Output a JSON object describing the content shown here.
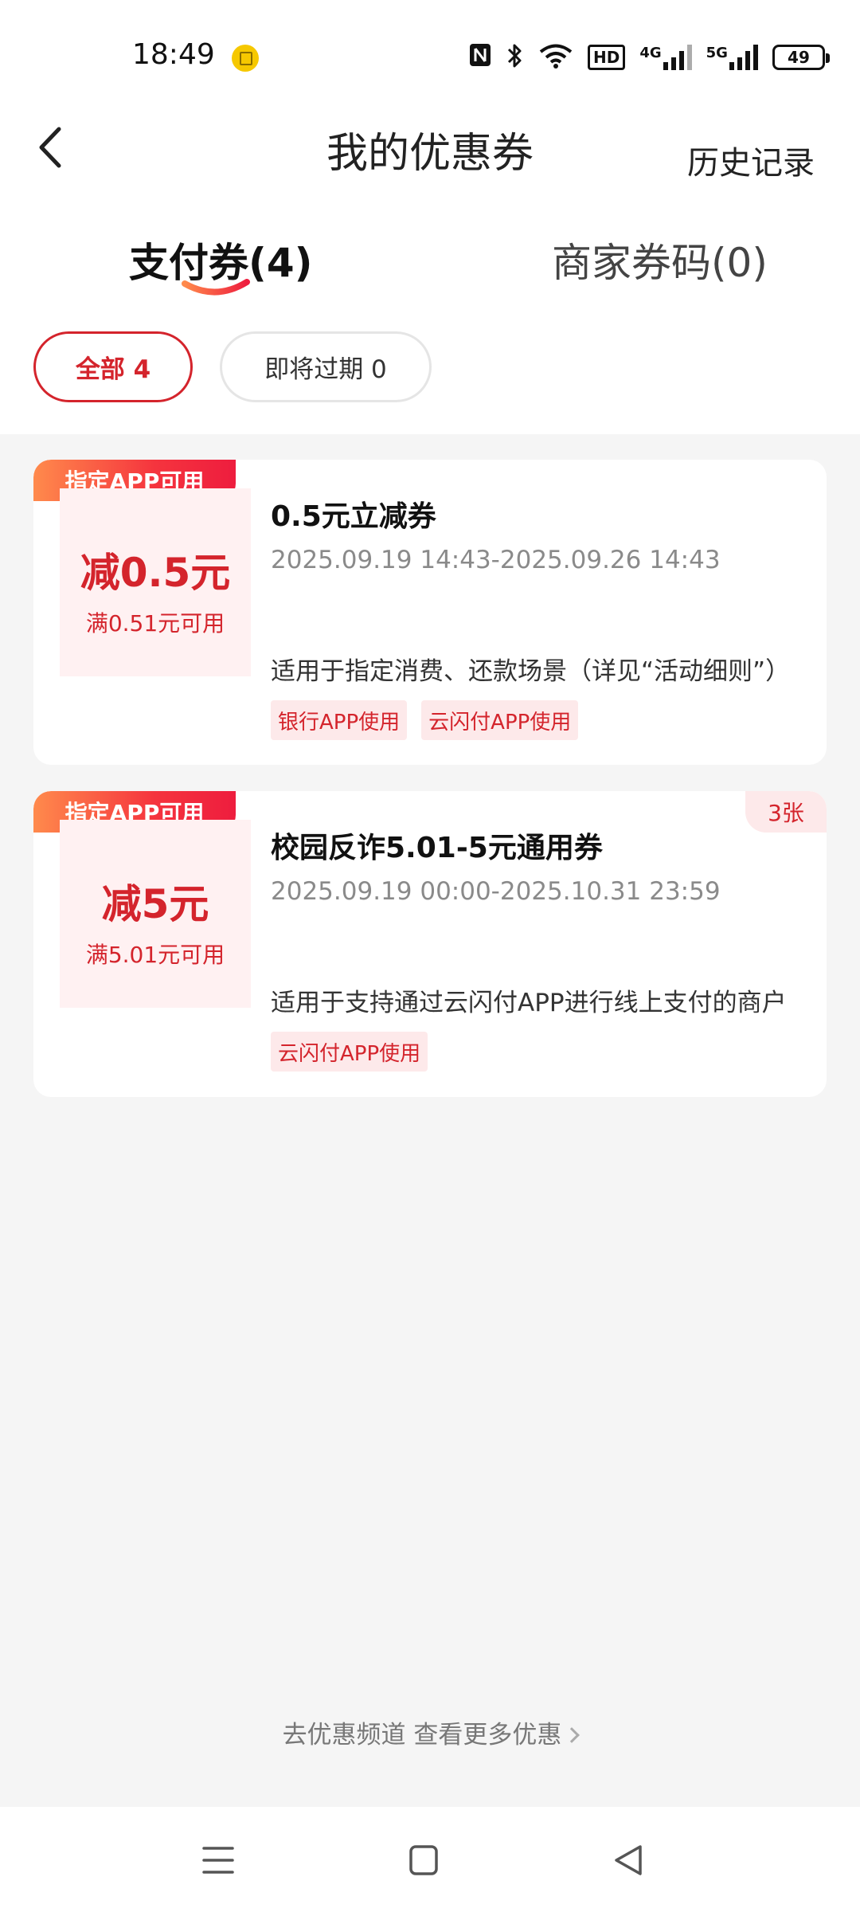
{
  "status_bar": {
    "time": "18:49",
    "network": "4G",
    "network2": "5G",
    "hd": "HD",
    "battery": "49"
  },
  "header": {
    "title": "我的优惠券",
    "history": "历史记录"
  },
  "tabs": [
    {
      "label": "支付券(4)",
      "active": true
    },
    {
      "label": "商家券码(0)",
      "active": false
    }
  ],
  "filters": [
    {
      "label": "全部 4",
      "active": true
    },
    {
      "label": "即将过期 0",
      "active": false
    }
  ],
  "coupons": [
    {
      "ribbon": "指定APP可用",
      "amount": "减0.5元",
      "condition": "满0.51元可用",
      "name": "0.5元立减券",
      "validity": "2025.09.19 14:43-2025.09.26 14:43",
      "description": "适用于指定消费、还款场景（详见“活动细则”）",
      "tags": [
        "银行APP使用",
        "云闪付APP使用"
      ]
    },
    {
      "ribbon": "指定APP可用",
      "amount": "减5元",
      "condition": "满5.01元可用",
      "name": "校园反诈5.01-5元通用券",
      "validity": "2025.09.19 00:00-2025.10.31 23:59",
      "description": "适用于支持通过云闪付APP进行线上支付的商户",
      "tags": [
        "云闪付APP使用"
      ],
      "count": "3张"
    }
  ],
  "footer": {
    "more_link": "去优惠频道 查看更多优惠"
  },
  "colors": {
    "accent": "#d4242c",
    "tag_bg": "#fde9ea",
    "ribbon_start": "#ff8a4c",
    "ribbon_end": "#ee1d3e"
  }
}
